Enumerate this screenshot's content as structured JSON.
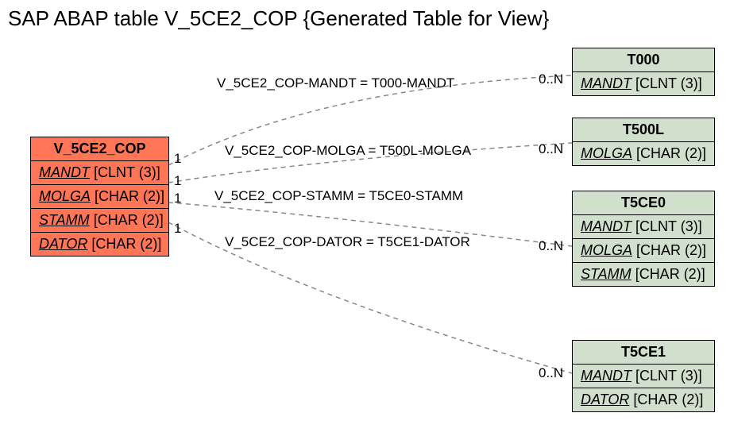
{
  "title": "SAP ABAP table V_5CE2_COP {Generated Table for View}",
  "colors": {
    "source": "#ff7556",
    "target": "#d1e0cc"
  },
  "source_table": {
    "name": "V_5CE2_COP",
    "fields": [
      {
        "key": "MANDT",
        "type": "[CLNT (3)]"
      },
      {
        "key": "MOLGA",
        "type": "[CHAR (2)]"
      },
      {
        "key": "STAMM",
        "type": "[CHAR (2)]"
      },
      {
        "key": "DATOR",
        "type": "[CHAR (2)]"
      }
    ]
  },
  "target_tables": [
    {
      "name": "T000",
      "fields": [
        {
          "key": "MANDT",
          "type": "[CLNT (3)]"
        }
      ]
    },
    {
      "name": "T500L",
      "fields": [
        {
          "key": "MOLGA",
          "type": "[CHAR (2)]"
        }
      ]
    },
    {
      "name": "T5CE0",
      "fields": [
        {
          "key": "MANDT",
          "type": "[CLNT (3)]"
        },
        {
          "key": "MOLGA",
          "type": "[CHAR (2)]"
        },
        {
          "key": "STAMM",
          "type": "[CHAR (2)]"
        }
      ]
    },
    {
      "name": "T5CE1",
      "fields": [
        {
          "key": "MANDT",
          "type": "[CLNT (3)]"
        },
        {
          "key": "DATOR",
          "type": "[CHAR (2)]"
        }
      ]
    }
  ],
  "relations": [
    {
      "label": "V_5CE2_COP-MANDT = T000-MANDT",
      "left_card": "1",
      "right_card": "0..N"
    },
    {
      "label": "V_5CE2_COP-MOLGA = T500L-MOLGA",
      "left_card": "1",
      "right_card": "0..N"
    },
    {
      "label": "V_5CE2_COP-STAMM = T5CE0-STAMM",
      "left_card": "1",
      "right_card": "0..N"
    },
    {
      "label": "V_5CE2_COP-DATOR = T5CE1-DATOR",
      "left_card": "1",
      "right_card": "0..N"
    }
  ]
}
